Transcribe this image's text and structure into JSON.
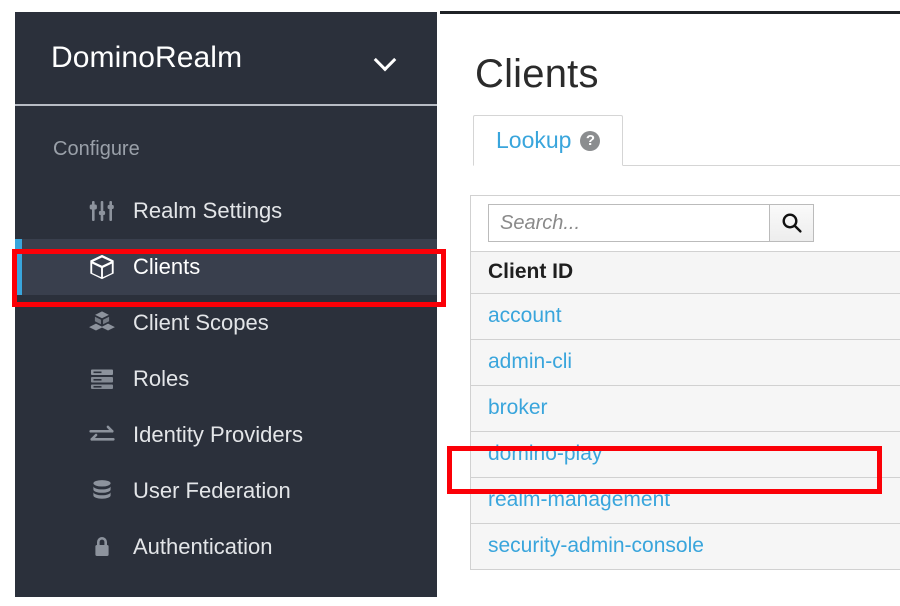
{
  "sidebar": {
    "realm_selector": {
      "name": "DominoRealm",
      "chevron_icon": "chevron-down-icon"
    },
    "nav_heading": "Configure",
    "items": [
      {
        "label": "Realm Settings",
        "icon": "sliders-icon",
        "active": false
      },
      {
        "label": "Clients",
        "icon": "cube-icon",
        "active": true
      },
      {
        "label": "Client Scopes",
        "icon": "cubes-icon",
        "active": false
      },
      {
        "label": "Roles",
        "icon": "list-icon",
        "active": false
      },
      {
        "label": "Identity Providers",
        "icon": "exchange-icon",
        "active": false
      },
      {
        "label": "User Federation",
        "icon": "database-icon",
        "active": false
      },
      {
        "label": "Authentication",
        "icon": "lock-icon",
        "active": false
      }
    ]
  },
  "main": {
    "page_title": "Clients",
    "tabs": [
      {
        "label": "Lookup",
        "help_icon": "question-circle-icon",
        "active": true
      }
    ],
    "search": {
      "value": "",
      "placeholder": "Search...",
      "button_icon": "search-icon"
    },
    "table": {
      "columns": [
        "Client ID"
      ],
      "rows": [
        {
          "client_id": "account"
        },
        {
          "client_id": "admin-cli"
        },
        {
          "client_id": "broker"
        },
        {
          "client_id": "domino-play"
        },
        {
          "client_id": "realm-management"
        },
        {
          "client_id": "security-admin-console"
        }
      ]
    }
  },
  "annotations": [
    {
      "name": "clients-nav-highlight",
      "color": "#fb0007"
    },
    {
      "name": "domino-play-row-highlight",
      "color": "#fb0007"
    }
  ],
  "colors": {
    "sidebar_bg": "#2b303b",
    "sidebar_active_bg": "#393f4d",
    "accent_blue": "#39a5dc",
    "annotation_red": "#fb0007",
    "link_blue": "#39a5dc"
  }
}
